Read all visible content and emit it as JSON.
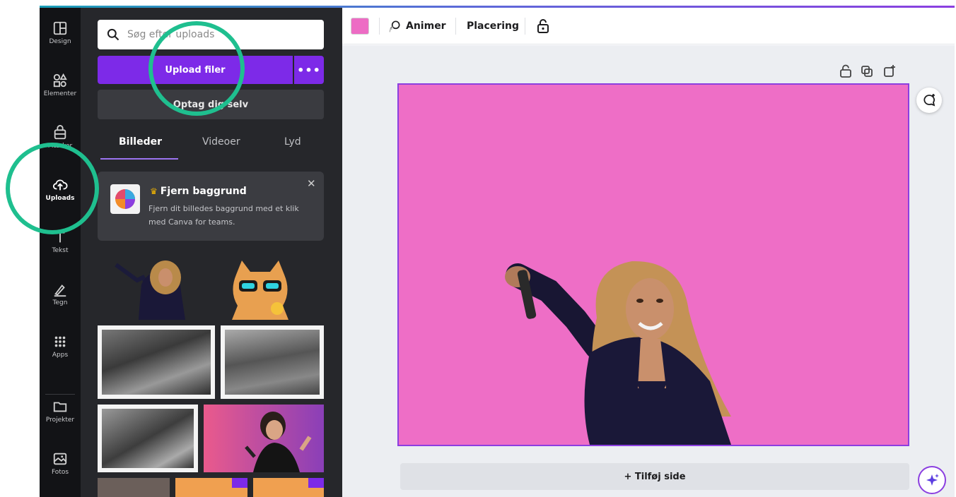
{
  "rail": {
    "items": [
      {
        "label": "Design",
        "icon": "layout-icon"
      },
      {
        "label": "Elementer",
        "icon": "shapes-icon"
      },
      {
        "label": "Mærker",
        "icon": "brand-icon"
      },
      {
        "label": "Uploads",
        "icon": "cloud-upload-icon"
      },
      {
        "label": "Tekst",
        "icon": "text-icon"
      },
      {
        "label": "Tegn",
        "icon": "draw-icon"
      },
      {
        "label": "Apps",
        "icon": "apps-grid-icon"
      },
      {
        "label": "Projekter",
        "icon": "folder-icon"
      },
      {
        "label": "Fotos",
        "icon": "photos-icon"
      }
    ]
  },
  "panel": {
    "search_placeholder": "Søg efter uploads",
    "upload_label": "Upload filer",
    "more_label": "•••",
    "record_label": "Optag dig selv",
    "tabs": [
      {
        "label": "Billeder"
      },
      {
        "label": "Videoer"
      },
      {
        "label": "Lyd"
      }
    ],
    "promo": {
      "title": "Fjern baggrund",
      "description": "Fjern dit billedes baggrund med et klik med Canva for teams.",
      "close": "✕"
    }
  },
  "toolbar": {
    "swatch_color": "#ed6cc4",
    "animate_label": "Animer",
    "position_label": "Placering"
  },
  "canvas": {
    "background_color": "#ee6ec6",
    "add_page_label": "+ Tilføj side"
  },
  "colors": {
    "accent": "#7d2ae8",
    "highlight": "#1fbf8f"
  }
}
